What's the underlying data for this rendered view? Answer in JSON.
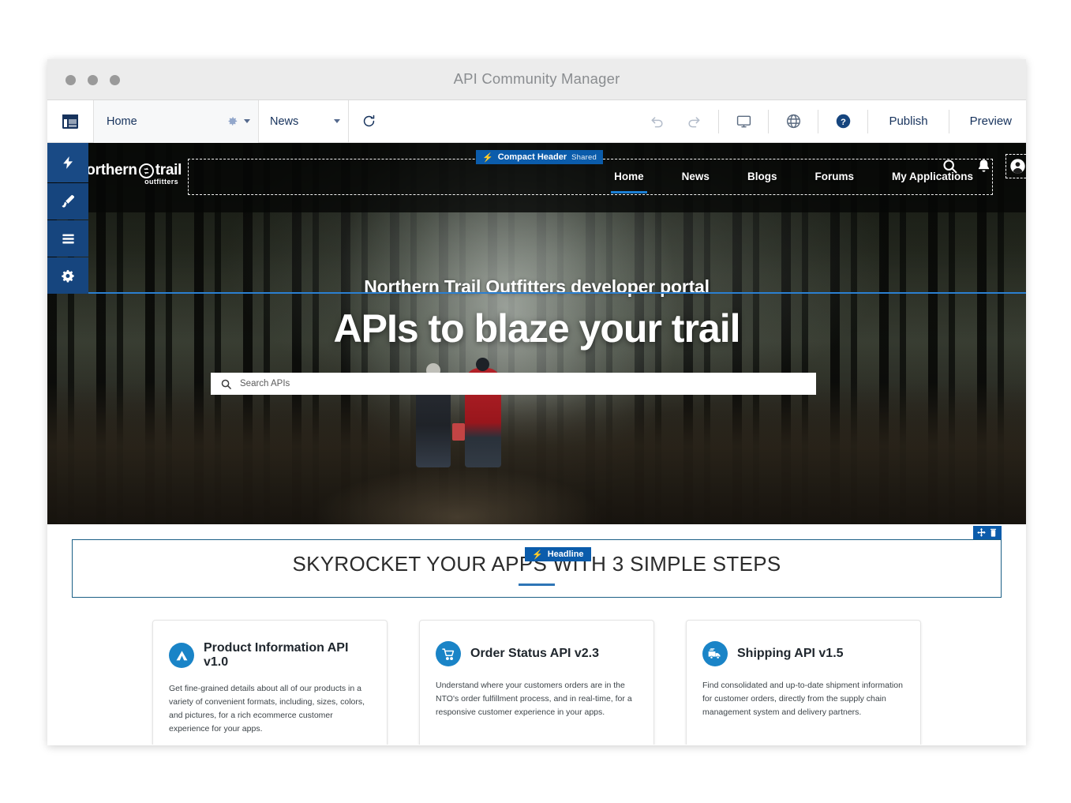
{
  "window": {
    "title": "API Community Manager",
    "traffic_lights": [
      "close",
      "minimize",
      "zoom"
    ]
  },
  "toolbar": {
    "panel_toggle_icon": "panel-layout-icon",
    "page_selector": {
      "label": "Home",
      "gear_icon": "gear-icon",
      "caret_icon": "chevron-down-icon"
    },
    "variation_selector": {
      "label": "News",
      "caret_icon": "chevron-down-icon"
    },
    "refresh_icon": "refresh-icon",
    "undo_icon": "undo-icon",
    "redo_icon": "redo-icon",
    "device_icon": "desktop-icon",
    "globe_icon": "globe-icon",
    "help_icon": "help-icon",
    "publish_label": "Publish",
    "preview_label": "Preview"
  },
  "builder_overlays": {
    "header_component": {
      "label": "Compact Header",
      "badge": "Shared",
      "bolt_icon": "lightning-icon"
    },
    "headline_component": {
      "label": "Headline",
      "bolt_icon": "lightning-icon"
    },
    "headline_tools": {
      "move_icon": "move-icon",
      "delete_icon": "trash-icon"
    }
  },
  "rail": {
    "items": [
      {
        "name": "lightning-icon",
        "title": "Components"
      },
      {
        "name": "brush-icon",
        "title": "Theme"
      },
      {
        "name": "list-icon",
        "title": "Content"
      },
      {
        "name": "gear-icon",
        "title": "Settings"
      }
    ]
  },
  "site": {
    "logo": {
      "word1": "northern",
      "word2": "trail",
      "sub": "outfitters",
      "mark": "♻"
    },
    "nav": [
      {
        "label": "Home",
        "active": true
      },
      {
        "label": "News",
        "active": false
      },
      {
        "label": "Blogs",
        "active": false
      },
      {
        "label": "Forums",
        "active": false
      },
      {
        "label": "My Applications",
        "active": false
      }
    ],
    "nav_icons": [
      {
        "name": "search-icon",
        "selected": false
      },
      {
        "name": "bell-icon",
        "selected": false
      },
      {
        "name": "user-avatar-icon",
        "selected": true
      }
    ],
    "hero": {
      "eyebrow": "Northern Trail Outfitters developer portal",
      "title": "APIs to blaze your trail",
      "search_placeholder": "Search APIs",
      "search_icon": "search-icon"
    },
    "headline": {
      "text": "SKYROCKET YOUR APPS WITH 3 SIMPLE STEPS"
    },
    "cards": [
      {
        "icon": "tent-icon",
        "title": "Product Information API v1.0",
        "body": "Get fine-grained details about all of our products in a variety of convenient formats, including, sizes, colors, and pictures, for a rich ecommerce customer experience for your apps."
      },
      {
        "icon": "shopping-cart-icon",
        "title": "Order Status API v2.3",
        "body": "Understand where your customers orders are in the NTO's order fulfillment process, and in real-time, for a responsive customer experience in your apps."
      },
      {
        "icon": "delivery-truck-icon",
        "title": "Shipping API v1.5",
        "body": "Find consolidated and up-to-date shipment information for customer orders, directly from the supply chain management system and delivery partners."
      }
    ]
  },
  "colors": {
    "accent_blue": "#0b5cab",
    "nav_active": "#1b7fd4",
    "rail_blue": "#16457e",
    "card_icon": "#1a84c7",
    "section_border": "#1b5f86"
  }
}
